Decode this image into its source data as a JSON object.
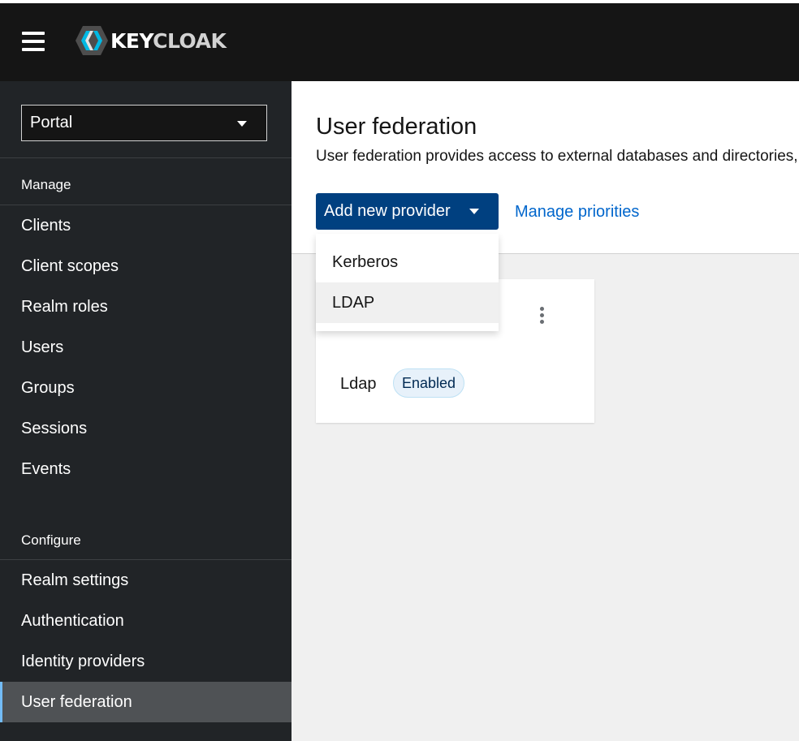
{
  "header": {
    "brand_prefix": "KEY",
    "brand_suffix": "CLOAK"
  },
  "sidebar": {
    "realm": "Portal",
    "sections": [
      {
        "title": "Manage",
        "items": [
          "Clients",
          "Client scopes",
          "Realm roles",
          "Users",
          "Groups",
          "Sessions",
          "Events"
        ]
      },
      {
        "title": "Configure",
        "items": [
          "Realm settings",
          "Authentication",
          "Identity providers",
          "User federation"
        ]
      }
    ],
    "active_item": "User federation"
  },
  "main": {
    "title": "User federation",
    "description": "User federation provides access to external databases and directories, such as LDAP and Active Directory.",
    "add_button_label": "Add new provider",
    "manage_priorities_label": "Manage priorities",
    "dropdown_items": [
      "Kerberos",
      "LDAP"
    ],
    "hovered_dropdown_item": "LDAP",
    "card": {
      "name": "Ldap",
      "status": "Enabled"
    }
  },
  "colors": {
    "topbar": "#151515",
    "sidebar": "#212427",
    "primary": "#004080",
    "link": "#0066cc",
    "active_nav": "#4f5255"
  }
}
